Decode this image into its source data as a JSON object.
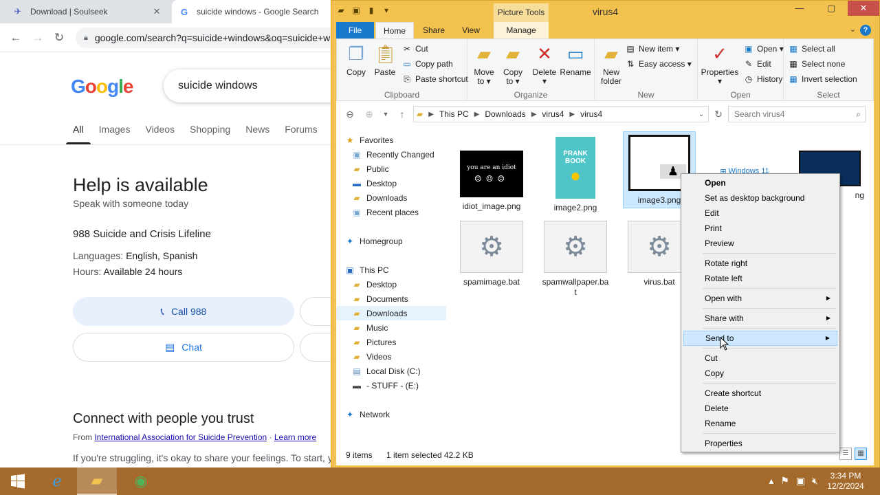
{
  "chrome": {
    "tabs": [
      {
        "title": "Download | Soulseek"
      },
      {
        "title": "suicide windows - Google Search"
      }
    ],
    "url": "google.com/search?q=suicide+windows&oq=suicide+windows",
    "search_query": "suicide windows",
    "result_tabs": [
      "All",
      "Images",
      "Videos",
      "Shopping",
      "News",
      "Forums"
    ],
    "help": {
      "title": "Help is available",
      "subtitle": "Speak with someone today",
      "lifeline": "988 Suicide and Crisis Lifeline",
      "languages_label": "Languages:",
      "languages": "English, Spanish",
      "hours_label": "Hours:",
      "hours": "Available 24 hours",
      "call_label": "Call 988",
      "chat_label": "Chat"
    },
    "connect": {
      "title": "Connect with people you trust",
      "from_prefix": "From",
      "source": "International Association for Suicide Prevention",
      "dot": "·",
      "learn_more": "Learn more",
      "body": "If you're struggling, it's okay to share your feelings. To start, y"
    }
  },
  "explorer": {
    "title": "virus4",
    "contextual_tab_group": "Picture Tools",
    "ribbon_tabs": [
      "File",
      "Home",
      "Share",
      "View",
      "Manage"
    ],
    "groups": {
      "clipboard": {
        "label": "Clipboard",
        "copy": "Copy",
        "paste": "Paste",
        "cut": "Cut",
        "copy_path": "Copy path",
        "paste_shortcut": "Paste shortcut"
      },
      "organize": {
        "label": "Organize",
        "move_to_1": "Move",
        "move_to_2": "to ▾",
        "copy_to_1": "Copy",
        "copy_to_2": "to ▾",
        "delete": "Delete",
        "delete_arrow": "▾",
        "rename": "Rename"
      },
      "new": {
        "label": "New",
        "new_folder_1": "New",
        "new_folder_2": "folder",
        "new_item": "New item ▾",
        "easy_access": "Easy access ▾"
      },
      "open": {
        "label": "Open",
        "properties": "Properties",
        "properties_arrow": "▾",
        "open": "Open ▾",
        "edit": "Edit",
        "history": "History"
      },
      "select": {
        "label": "Select",
        "select_all": "Select all",
        "select_none": "Select none",
        "invert_selection": "Invert selection"
      }
    },
    "breadcrumb": [
      "This PC",
      "Downloads",
      "virus4",
      "virus4"
    ],
    "search_placeholder": "Search virus4",
    "nav": {
      "favorites": "Favorites",
      "recently_changed": "Recently Changed",
      "public": "Public",
      "desktop": "Desktop",
      "downloads": "Downloads",
      "recent_places": "Recent places",
      "homegroup": "Homegroup",
      "this_pc": "This PC",
      "pc_desktop": "Desktop",
      "documents": "Documents",
      "pc_downloads": "Downloads",
      "music": "Music",
      "pictures": "Pictures",
      "videos": "Videos",
      "local_disk": "Local Disk (C:)",
      "stuff": "- STUFF - (E:)",
      "network": "Network"
    },
    "files": {
      "f1": "idiot_image.png",
      "f1_thumb_text": "you are an idiot",
      "f2": "image2.png",
      "f2_thumb_text_1": "PRANK",
      "f2_thumb_text_2": "BOOK",
      "f3": "image3.png",
      "f4_thumb_text": "Windows 11",
      "f5_partial": "ng",
      "f6": "spamimage.bat",
      "f7": "spamwallpaper.bat",
      "f8": "virus.bat"
    },
    "status": {
      "items": "9 items",
      "selected": "1 item selected",
      "size": "42.2 KB"
    }
  },
  "context_menu": {
    "open": "Open",
    "set_desktop_bg": "Set as desktop background",
    "edit": "Edit",
    "print": "Print",
    "preview": "Preview",
    "rotate_right": "Rotate right",
    "rotate_left": "Rotate left",
    "open_with": "Open with",
    "share_with": "Share with",
    "send_to": "Send to",
    "cut": "Cut",
    "copy": "Copy",
    "create_shortcut": "Create shortcut",
    "delete": "Delete",
    "rename": "Rename",
    "properties": "Properties"
  },
  "taskbar": {
    "time": "3:34 PM",
    "date": "12/2/2024"
  },
  "colors": {
    "explorer_frame": "#f3c24e",
    "file_tab": "#1979ca",
    "taskbar": "#a36a2c",
    "selection": "#cce8ff",
    "close_button": "#c7504b"
  }
}
